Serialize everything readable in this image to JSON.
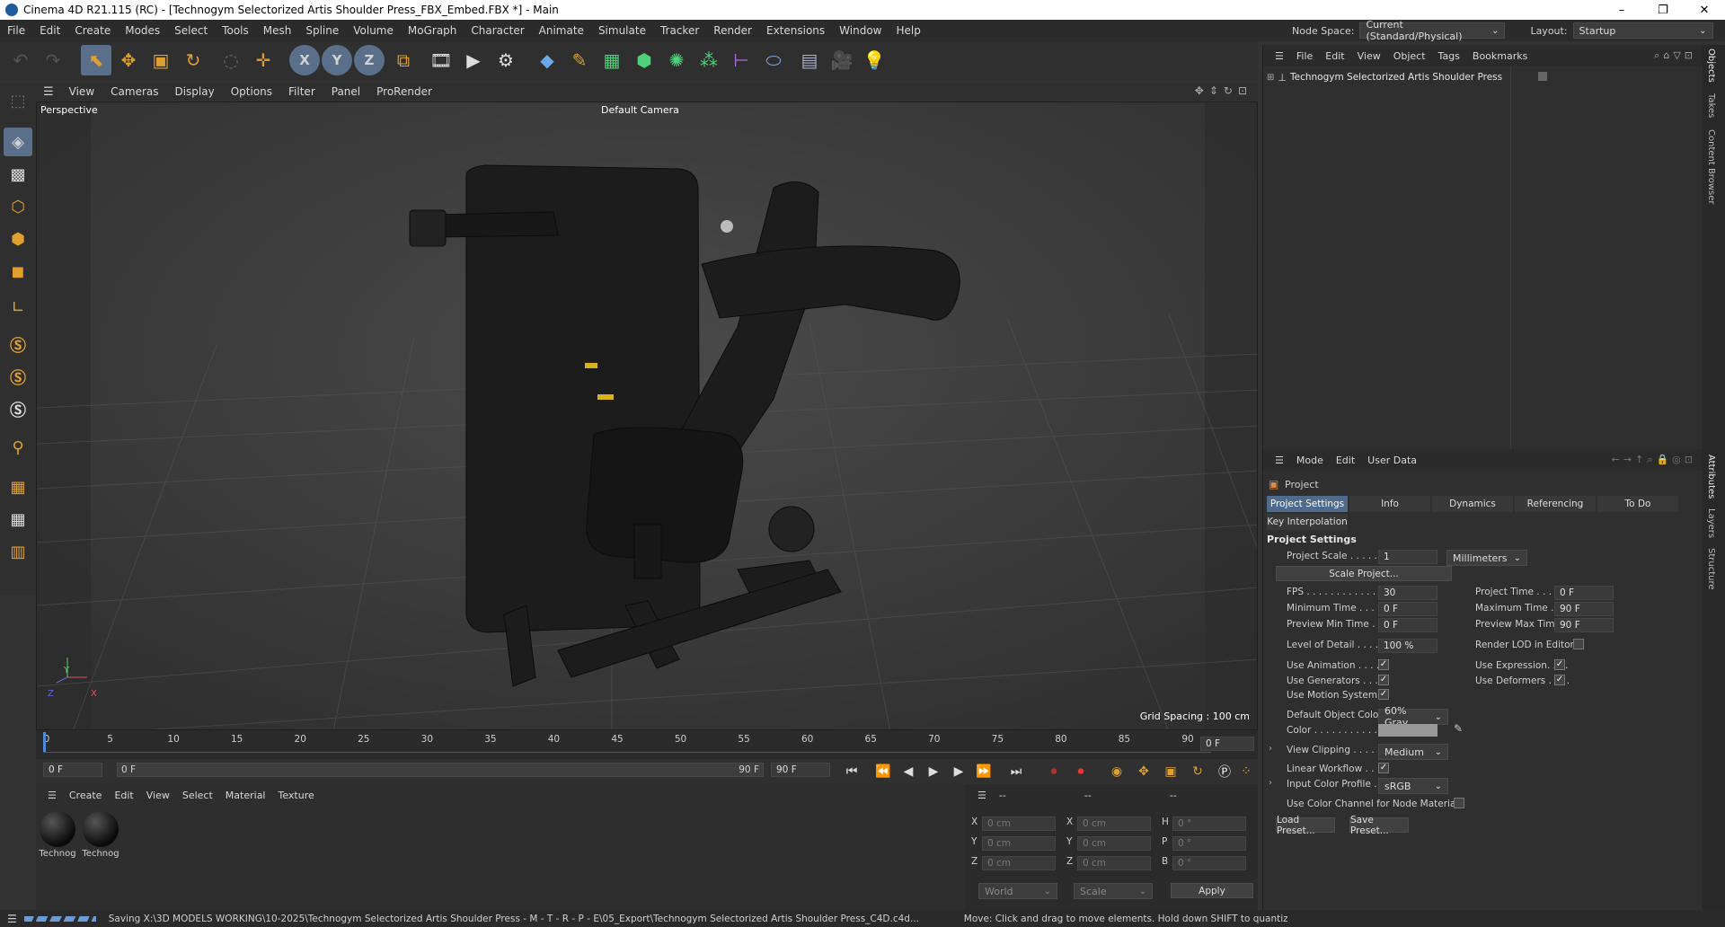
{
  "window": {
    "title": "Cinema 4D R21.115 (RC) - [Technogym Selectorized Artis Shoulder Press_FBX_Embed.FBX *] - Main",
    "controls": [
      "–",
      "❐",
      "✕"
    ]
  },
  "menubar": {
    "items": [
      "File",
      "Edit",
      "Create",
      "Modes",
      "Select",
      "Tools",
      "Mesh",
      "Spline",
      "Volume",
      "MoGraph",
      "Character",
      "Animate",
      "Simulate",
      "Tracker",
      "Render",
      "Extensions",
      "Window",
      "Help"
    ],
    "node_space_label": "Node Space:",
    "node_space_value": "Current (Standard/Physical)",
    "layout_label": "Layout:",
    "layout_value": "Startup"
  },
  "toolbar": {
    "axis_x": "X",
    "axis_y": "Y",
    "axis_z": "Z"
  },
  "viewport": {
    "menu": [
      "View",
      "Cameras",
      "Display",
      "Options",
      "Filter",
      "Panel",
      "ProRender"
    ],
    "label": "Perspective",
    "camera": "Default Camera",
    "grid_spacing": "Grid Spacing : 100 cm",
    "axis_y": "Y",
    "axis_z": "Z",
    "axis_x": "X"
  },
  "timeline": {
    "ticks": [
      "0",
      "5",
      "10",
      "15",
      "20",
      "25",
      "30",
      "35",
      "40",
      "45",
      "50",
      "55",
      "60",
      "65",
      "70",
      "75",
      "80",
      "85",
      "90"
    ],
    "current_frame": "0 F"
  },
  "transport": {
    "start": "0 F",
    "range_start": "0 F",
    "range_end": "90 F",
    "end": "90 F"
  },
  "materials": {
    "menu": [
      "Create",
      "Edit",
      "View",
      "Select",
      "Material",
      "Texture"
    ],
    "items": [
      {
        "label": "Technog"
      },
      {
        "label": "Technog"
      }
    ]
  },
  "coords": {
    "headers": [
      "--",
      "--",
      "--"
    ],
    "rows": [
      {
        "a": "X",
        "av": "0 cm",
        "b": "X",
        "bv": "0 cm",
        "c": "H",
        "cv": "0 °"
      },
      {
        "a": "Y",
        "av": "0 cm",
        "b": "Y",
        "bv": "0 cm",
        "c": "P",
        "cv": "0 °"
      },
      {
        "a": "Z",
        "av": "0 cm",
        "b": "Z",
        "bv": "0 cm",
        "c": "B",
        "cv": "0 °"
      }
    ],
    "world": "World",
    "scale": "Scale",
    "apply": "Apply"
  },
  "objects": {
    "menu": [
      "File",
      "Edit",
      "View",
      "Object",
      "Tags",
      "Bookmarks"
    ],
    "item": "Technogym Selectorized Artis Shoulder Press"
  },
  "side_tabs": [
    "Objects",
    "Takes",
    "Content Browser",
    "Attributes",
    "Layers",
    "Structure"
  ],
  "attributes": {
    "menu": [
      "Mode",
      "Edit",
      "User Data"
    ],
    "header": "Project",
    "tabs": [
      "Project Settings",
      "Info",
      "Dynamics",
      "Referencing",
      "To Do"
    ],
    "tab2": "Key Interpolation",
    "section": "Project Settings",
    "project_scale_label": "Project Scale . . . . .",
    "project_scale_value": "1",
    "project_scale_unit": "Millimeters",
    "scale_project_btn": "Scale Project...",
    "fps_label": "FPS . . . . . . . . . . . .",
    "fps_value": "30",
    "project_time_label": "Project Time . . . . .",
    "project_time_value": "0 F",
    "min_time_label": "Minimum Time . . .",
    "min_time_value": "0 F",
    "max_time_label": "Maximum Time . . .",
    "max_time_value": "90 F",
    "prev_min_label": "Preview Min Time . .",
    "prev_min_value": "0 F",
    "prev_max_label": "Preview Max Time .",
    "prev_max_value": "90 F",
    "lod_label": "Level of Detail . . . .",
    "lod_value": "100 %",
    "render_lod_label": "Render LOD in Editor",
    "use_anim_label": "Use Animation . . . .",
    "use_expr_label": "Use Expression. . . .",
    "use_gen_label": "Use Generators . . .",
    "use_def_label": "Use Deformers . . . .",
    "use_motion_label": "Use Motion System",
    "default_color_label": "Default Object Color",
    "default_color_value": "60% Gray",
    "color_label": "Color . . . . . . . . . . .",
    "view_clip_label": "View Clipping . . . .",
    "view_clip_value": "Medium",
    "linear_label": "Linear Workflow . . .",
    "input_profile_label": "Input Color Profile .",
    "input_profile_value": "sRGB",
    "use_color_channel_label": "Use Color Channel for Node Material",
    "load_preset": "Load Preset...",
    "save_preset": "Save Preset...",
    "check_mark": "✓"
  },
  "status": {
    "left": "Saving X:\\3D MODELS WORKING\\10-2025\\Technogym Selectorized Artis Shoulder Press - M - T - R - P - E\\05_Export\\Technogym Selectorized Artis Shoulder Press_C4D.c4d...",
    "right": "Move: Click and drag to move elements. Hold down SHIFT to quantize mo"
  },
  "colors": {
    "accent": "#4e6a8c",
    "selection": "#5a6f8a",
    "model": "#1a1a1a",
    "seat_accent": "#d7b21a"
  }
}
